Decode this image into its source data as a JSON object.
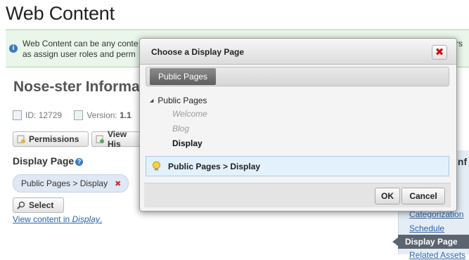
{
  "page": {
    "title": "Web Content",
    "info_line1": "Web Content can be any conte",
    "info_line2": "as assign user roles and perm",
    "info_right": "ators"
  },
  "article": {
    "title": "Nose-ster Informa",
    "id_label": "ID:",
    "id_value": "12729",
    "version_label": "Version:",
    "version_value": "1.1"
  },
  "toolbar": {
    "permissions_label": "Permissions",
    "view_history_label": "View His"
  },
  "display_page": {
    "label": "Display Page",
    "help": "?",
    "selected": "Public Pages > Display",
    "remove": "✖",
    "select_label": "Select",
    "view_link_prefix": "View content in",
    "view_link_target": "Display",
    "view_link_suffix": "."
  },
  "side_panel": {
    "heading": "Inf",
    "links": [
      "Categorization",
      "Schedule"
    ],
    "active": "Display Page",
    "partial": "Related Assets"
  },
  "dialog": {
    "title": "Choose a Display Page",
    "close": "✖",
    "tab": "Public Pages",
    "tree_root": "Public Pages",
    "tree_toggle": "◢",
    "children": [
      "Welcome",
      "Blog",
      "Display"
    ],
    "selection": "Public Pages > Display",
    "ok": "OK",
    "cancel": "Cancel"
  },
  "colors": {
    "accent": "#2a64a8",
    "close_red": "#c0141a",
    "selection_bg": "#e2f1fb",
    "info_bg": "#eaf6ea"
  }
}
